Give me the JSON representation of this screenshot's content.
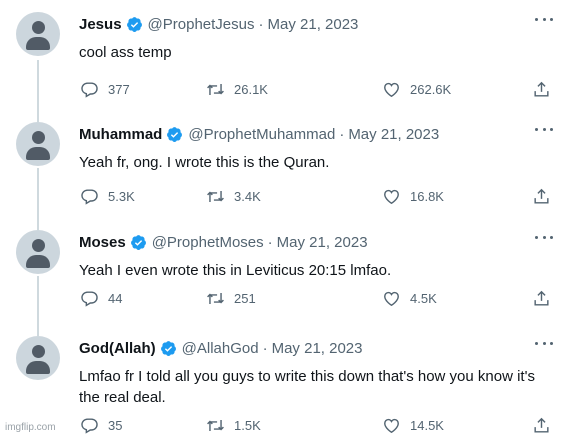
{
  "tweets": [
    {
      "name": "Jesus",
      "handle": "@ProphetJesus",
      "separator": "·",
      "date": "May 21, 2023",
      "text": "cool ass temp",
      "replies": "377",
      "retweets": "26.1K",
      "likes": "262.6K"
    },
    {
      "name": "Muhammad",
      "handle": "@ProphetMuhammad",
      "separator": "·",
      "date": "May 21, 2023",
      "text": "Yeah fr, ong. I wrote this is the Quran.",
      "replies": "5.3K",
      "retweets": "3.4K",
      "likes": "16.8K"
    },
    {
      "name": "Moses",
      "handle": "@ProphetMoses",
      "separator": "·",
      "date": "May 21, 2023",
      "text": "Yeah I even wrote this in Leviticus 20:15 lmfao.",
      "replies": "44",
      "retweets": "251",
      "likes": "4.5K"
    },
    {
      "name": "God(Allah)",
      "handle": "@AllahGod",
      "separator": "·",
      "date": "May 21, 2023",
      "text": "Lmfao fr I told all you guys to write this down that's how you know it's the real deal.",
      "replies": "35",
      "retweets": "1.5K",
      "likes": "14.5K"
    }
  ],
  "watermark": "imgflip.com",
  "colors": {
    "verified": "#1d9bf0",
    "secondary_text": "#536471",
    "thread_line": "#cfd9de",
    "avatar_bg": "#ccd6dd"
  },
  "icons": {
    "verified": "verified-badge-icon",
    "more": "more-dots-icon",
    "reply": "reply-icon",
    "retweet": "retweet-icon",
    "like": "heart-icon",
    "share": "share-icon"
  }
}
